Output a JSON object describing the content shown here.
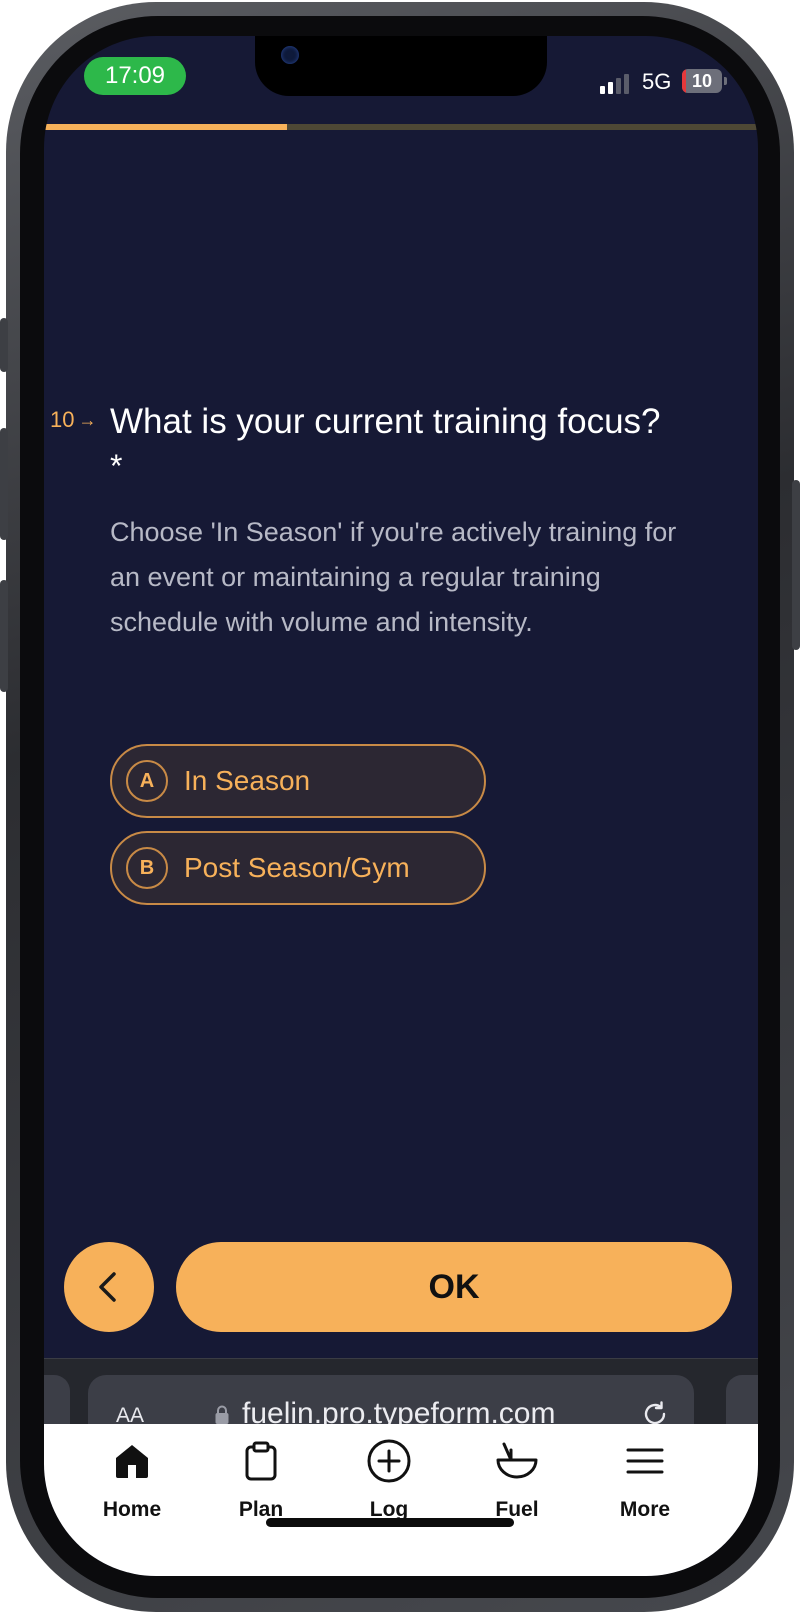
{
  "status_bar": {
    "time": "17:09",
    "network": "5G",
    "battery": "10",
    "battery_level": 0.1
  },
  "form": {
    "progress": 0.34,
    "question_number": "10",
    "question_title": "What is your current training focus?",
    "required_marker": "*",
    "description": "Choose 'In Season' if you're actively training for an event or maintaining a regular training schedule with volume and intensity.",
    "choices": [
      {
        "key": "A",
        "label": "In Season"
      },
      {
        "key": "B",
        "label": "Post Season/Gym"
      }
    ],
    "ok_label": "OK"
  },
  "browser": {
    "text_size_label": "AA",
    "url": "fuelin.pro.typeform.com"
  },
  "tabbar": {
    "tabs": [
      {
        "label": "Home",
        "icon": "home-icon",
        "active": true
      },
      {
        "label": "Plan",
        "icon": "clipboard-icon",
        "active": false
      },
      {
        "label": "Log",
        "icon": "plus-circle-icon",
        "active": false
      },
      {
        "label": "Fuel",
        "icon": "bowl-icon",
        "active": false
      },
      {
        "label": "More",
        "icon": "menu-icon",
        "active": false
      }
    ]
  },
  "colors": {
    "background": "#161935",
    "accent": "#f7b15a",
    "status_green": "#2db84a"
  }
}
